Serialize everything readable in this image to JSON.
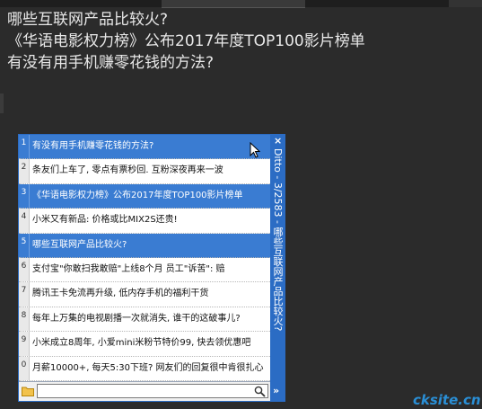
{
  "document": {
    "lines": [
      "哪些互联网产品比较火?",
      "《华语电影权力榜》公布2017年度TOP100影片榜单",
      "有没有用手机赚零花钱的方法?"
    ]
  },
  "ditto": {
    "title": "Ditto - 3/2583 - 哪些互联网产品比较火?",
    "selected_rows": [
      1,
      3,
      5
    ],
    "items": [
      {
        "num": "1",
        "text": "有没有用手机赚零花钱的方法?"
      },
      {
        "num": "2",
        "text": "条友们上车了, 零点有票秒回. 互粉深夜再来一波"
      },
      {
        "num": "3",
        "text": "《华语电影权力榜》公布2017年度TOP100影片榜单"
      },
      {
        "num": "4",
        "text": "小米又有新品: 价格或比MIX2S还贵!"
      },
      {
        "num": "5",
        "text": "哪些互联网产品比较火?"
      },
      {
        "num": "6",
        "text": "支付宝\"你敢扫我敢赔\"上线8个月 员工\"诉苦\": 赔"
      },
      {
        "num": "7",
        "text": "腾讯王卡免流再升级, 低内存手机的福利干货"
      },
      {
        "num": "8",
        "text": "每年上万集的电视剧播一次就消失, 谁干的这破事儿?"
      },
      {
        "num": "9",
        "text": "小米成立8周年, 小爱mini米粉节特价99, 快去领优惠吧"
      },
      {
        "num": "0",
        "text": "月薪10000+, 每天5:30下班? 网友们的回复很中肯很扎心"
      }
    ],
    "search": {
      "value": "",
      "placeholder": ""
    }
  },
  "watermark": "cksite.cn",
  "colors": {
    "background": "#2b2b2b",
    "ditto_frame": "#2b6cc4",
    "selected_row": "#3a7cd2",
    "watermark": "#2a8fd6"
  }
}
